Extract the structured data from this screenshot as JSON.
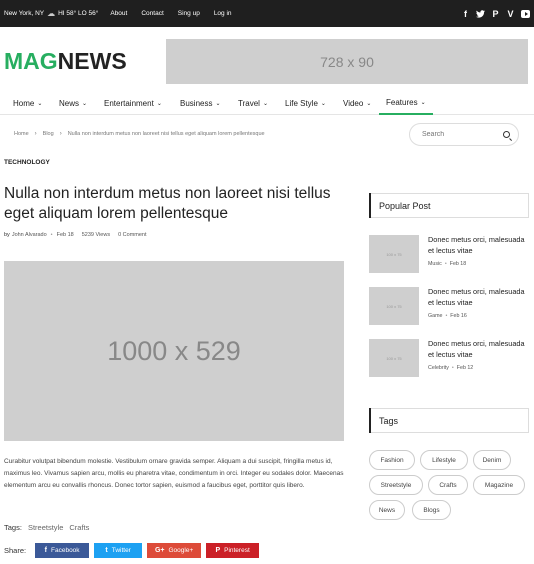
{
  "topbar": {
    "weather": {
      "location": "New York, NY",
      "temps": "HI 58° LO 56°",
      "icon": "cloud-icon"
    },
    "links": [
      "About",
      "Contact",
      "Sing up",
      "Log in"
    ],
    "social_icons": [
      "facebook-icon",
      "twitter-icon",
      "pinterest-icon",
      "vimeo-icon",
      "youtube-icon"
    ]
  },
  "header": {
    "logo_part1": "MAG",
    "logo_part2": "NEWS",
    "ad_text": "728 x 90"
  },
  "nav": {
    "items": [
      {
        "label": "Home"
      },
      {
        "label": "News"
      },
      {
        "label": "Entertainment"
      },
      {
        "label": "Business"
      },
      {
        "label": "Travel"
      },
      {
        "label": "Life Style"
      },
      {
        "label": "Video"
      },
      {
        "label": "Features"
      }
    ],
    "active": "Features"
  },
  "breadcrumb": {
    "items": [
      "Home",
      "Blog",
      "Nulla non interdum metus non laoreet nisi tellus eget aliquam lorem pellentesque"
    ]
  },
  "search": {
    "placeholder": "Search"
  },
  "article": {
    "category": "TECHNOLOGY",
    "title": "Nulla non interdum metus non laoreet nisi tellus eget aliquam lorem pellentesque",
    "meta": {
      "author_prefix": "by",
      "author": "John Alvarado",
      "date": "Feb 18",
      "views": "5239 Views",
      "comments": "0 Comment"
    },
    "hero_text": "1000 x 529",
    "body": "Curabitur volutpat bibendum molestie. Vestibulum ornare gravida semper. Aliquam a dui suscipit, fringilla metus id, maximus leo. Vivamus sapien arcu, mollis eu pharetra vitae, condimentum in orci. Integer eu sodales dolor. Maecenas elementum arcu eu convallis rhoncus. Donec tortor sapien, euismod a faucibus eget, porttitor quis libero.",
    "tags_label": "Tags:",
    "tags": [
      "Streetstyle",
      "Crafts"
    ],
    "share_label": "Share:",
    "share_buttons": [
      {
        "icon": "f",
        "label": "Facebook"
      },
      {
        "icon": "t",
        "label": "Twitter"
      },
      {
        "icon": "G+",
        "label": "Google+"
      },
      {
        "icon": "P",
        "label": "Pinterest"
      }
    ]
  },
  "sidebar": {
    "popular_title": "Popular Post",
    "popular": [
      {
        "thumb": "100 x 75",
        "title": "Donec metus orci, malesuada et lectus vitae",
        "category": "Music",
        "date": "Feb 18"
      },
      {
        "thumb": "100 x 75",
        "title": "Donec metus orci, malesuada et lectus vitae",
        "category": "Game",
        "date": "Feb 16"
      },
      {
        "thumb": "100 x 75",
        "title": "Donec metus orci, malesuada et lectus vitae",
        "category": "Celebrity",
        "date": "Feb 12"
      }
    ],
    "tags_title": "Tags",
    "tags": [
      "Fashion",
      "Lifestyle",
      "Denim",
      "Streetstyle",
      "Crafts",
      "Magazine",
      "News",
      "Blogs"
    ]
  },
  "colors": {
    "brand_green": "#27ae60",
    "topbar_bg": "#1f1f1f",
    "facebook": "#3b5998",
    "twitter": "#1da1f2",
    "google_plus": "#dd4b39",
    "pinterest": "#cb2027"
  }
}
